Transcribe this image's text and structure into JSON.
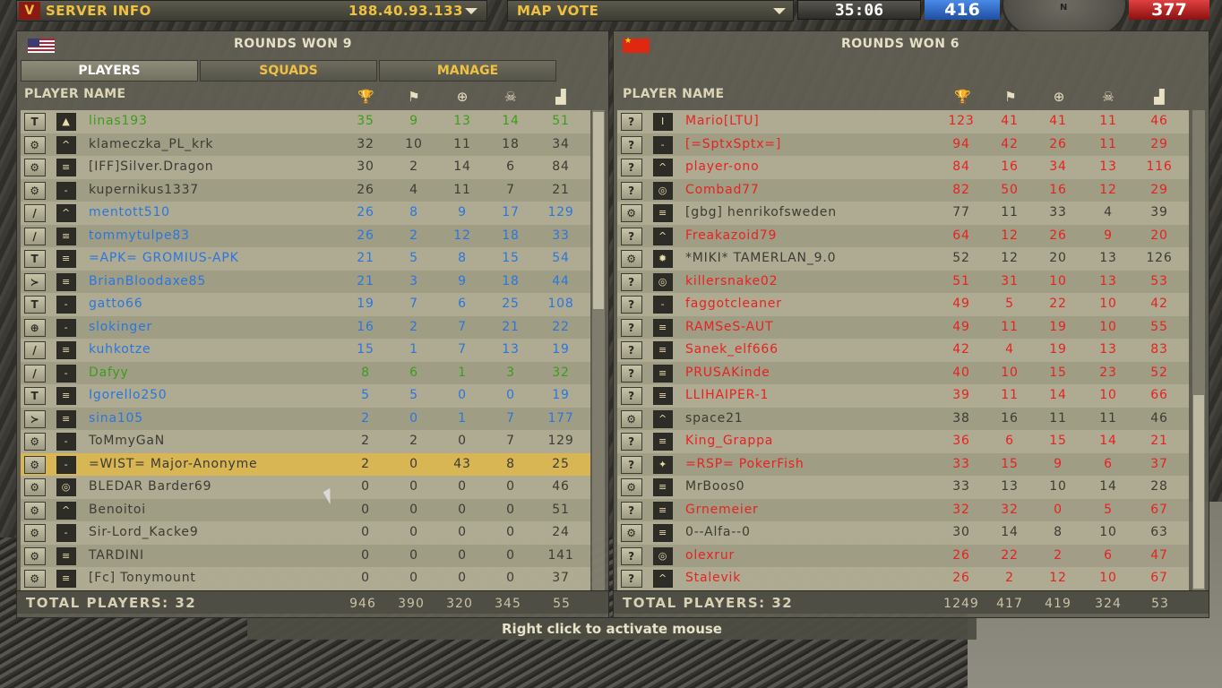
{
  "topbar": {
    "server_label": "SERVER INFO",
    "server_ip": "188.40.93.133",
    "mapvote_label": "MAP VOTE",
    "timer": "35:06",
    "score_us": "416",
    "score_ch": "377",
    "compass_n": "N"
  },
  "headers": {
    "player_name": "PLAYER NAME",
    "icons": [
      "trophy-icon",
      "flag-icon",
      "crosshair-icon",
      "skull-icon",
      "ping-icon"
    ]
  },
  "left": {
    "rounds_won": "ROUNDS WON 9",
    "tabs": [
      "PLAYERS",
      "SQUADS",
      "MANAGE"
    ],
    "total_players": "TOTAL PLAYERS: 32",
    "totals": [
      "946",
      "390",
      "320",
      "345",
      "55"
    ],
    "players": [
      {
        "kit": "T",
        "rank": "▲",
        "name": "linas193",
        "color": "green",
        "s": [
          "35",
          "9",
          "13",
          "14",
          "51"
        ]
      },
      {
        "kit": "⚙",
        "rank": "^",
        "name": "klameczka_PL_krk",
        "color": "black",
        "s": [
          "32",
          "10",
          "11",
          "18",
          "34"
        ]
      },
      {
        "kit": "⚙",
        "rank": "≡",
        "name": "[IFF]Silver.Dragon",
        "color": "black",
        "s": [
          "30",
          "2",
          "14",
          "6",
          "84"
        ]
      },
      {
        "kit": "⚙",
        "rank": "-",
        "name": "kupernikus1337",
        "color": "black",
        "s": [
          "26",
          "4",
          "11",
          "7",
          "21"
        ]
      },
      {
        "kit": "/",
        "rank": "^",
        "name": "mentott510",
        "color": "blue",
        "s": [
          "26",
          "8",
          "9",
          "17",
          "129"
        ]
      },
      {
        "kit": "/",
        "rank": "≡",
        "name": "tommytulpe83",
        "color": "blue",
        "s": [
          "26",
          "2",
          "12",
          "18",
          "33"
        ]
      },
      {
        "kit": "T",
        "rank": "≡",
        "name": "=APK= GROMIUS-APK",
        "color": "blue",
        "s": [
          "21",
          "5",
          "8",
          "15",
          "54"
        ]
      },
      {
        "kit": "≻",
        "rank": "≡",
        "name": "BrianBloodaxe85",
        "color": "blue",
        "s": [
          "21",
          "3",
          "9",
          "18",
          "44"
        ]
      },
      {
        "kit": "T",
        "rank": "-",
        "name": "gatto66",
        "color": "blue",
        "s": [
          "19",
          "7",
          "6",
          "25",
          "108"
        ]
      },
      {
        "kit": "⊕",
        "rank": "-",
        "name": "slokinger",
        "color": "blue",
        "s": [
          "16",
          "2",
          "7",
          "21",
          "22"
        ]
      },
      {
        "kit": "/",
        "rank": "≡",
        "name": "kuhkotze",
        "color": "blue",
        "s": [
          "15",
          "1",
          "7",
          "13",
          "19"
        ]
      },
      {
        "kit": "/",
        "rank": "-",
        "name": "Dafyy",
        "color": "green",
        "s": [
          "8",
          "6",
          "1",
          "3",
          "32"
        ]
      },
      {
        "kit": "T",
        "rank": "≡",
        "name": "Igorello250",
        "color": "blue",
        "s": [
          "5",
          "5",
          "0",
          "0",
          "19"
        ]
      },
      {
        "kit": "≻",
        "rank": "≡",
        "name": "sina105",
        "color": "blue",
        "s": [
          "2",
          "0",
          "1",
          "7",
          "177"
        ]
      },
      {
        "kit": "⚙",
        "rank": "-",
        "name": "ToMmyGaN",
        "color": "black",
        "s": [
          "2",
          "2",
          "0",
          "7",
          "129"
        ]
      },
      {
        "kit": "⚙",
        "rank": "-",
        "name": "=WIST= Major-Anonyme",
        "color": "black",
        "s": [
          "2",
          "0",
          "43",
          "8",
          "25"
        ],
        "hl": true
      },
      {
        "kit": "⚙",
        "rank": "◎",
        "name": "BLEDAR Barder69",
        "color": "black",
        "s": [
          "0",
          "0",
          "0",
          "0",
          "46"
        ]
      },
      {
        "kit": "⚙",
        "rank": "^",
        "name": "Benoitoi",
        "color": "black",
        "s": [
          "0",
          "0",
          "0",
          "0",
          "51"
        ]
      },
      {
        "kit": "⚙",
        "rank": "-",
        "name": "Sir-Lord_Kacke9",
        "color": "black",
        "s": [
          "0",
          "0",
          "0",
          "0",
          "24"
        ]
      },
      {
        "kit": "⚙",
        "rank": "≡",
        "name": "TARDINI",
        "color": "black",
        "s": [
          "0",
          "0",
          "0",
          "0",
          "141"
        ]
      },
      {
        "kit": "⚙",
        "rank": "≡",
        "name": "[Fc] Tonymount",
        "color": "black",
        "s": [
          "0",
          "0",
          "0",
          "0",
          "37"
        ]
      }
    ]
  },
  "right": {
    "rounds_won": "ROUNDS WON 6",
    "total_players": "TOTAL PLAYERS: 32",
    "totals": [
      "1249",
      "417",
      "419",
      "324",
      "53"
    ],
    "players": [
      {
        "kit": "?",
        "rank": "I",
        "name": "Mario[LTU]",
        "color": "red",
        "s": [
          "123",
          "41",
          "41",
          "11",
          "46"
        ]
      },
      {
        "kit": "?",
        "rank": "-",
        "name": "[=SptxSptx=]",
        "color": "red",
        "s": [
          "94",
          "42",
          "26",
          "11",
          "29"
        ]
      },
      {
        "kit": "?",
        "rank": "^",
        "name": "player-ono",
        "color": "red",
        "s": [
          "84",
          "16",
          "34",
          "13",
          "116"
        ]
      },
      {
        "kit": "?",
        "rank": "◎",
        "name": "Combad77",
        "color": "red",
        "s": [
          "82",
          "50",
          "16",
          "12",
          "29"
        ]
      },
      {
        "kit": "⚙",
        "rank": "≡",
        "name": "[gbg] henrikofsweden",
        "color": "black",
        "s": [
          "77",
          "11",
          "33",
          "4",
          "39"
        ]
      },
      {
        "kit": "?",
        "rank": "^",
        "name": "Freakazoid79",
        "color": "red",
        "s": [
          "64",
          "12",
          "26",
          "9",
          "20"
        ]
      },
      {
        "kit": "⚙",
        "rank": "✹",
        "name": "*MIKI* TAMERLAN_9.0",
        "color": "black",
        "s": [
          "52",
          "12",
          "20",
          "13",
          "126"
        ]
      },
      {
        "kit": "?",
        "rank": "◎",
        "name": "killersnake02",
        "color": "red",
        "s": [
          "51",
          "31",
          "10",
          "13",
          "53"
        ]
      },
      {
        "kit": "?",
        "rank": "-",
        "name": "faggotcleaner",
        "color": "red",
        "s": [
          "49",
          "5",
          "22",
          "10",
          "42"
        ]
      },
      {
        "kit": "?",
        "rank": "≡",
        "name": "RAMSeS-AUT",
        "color": "red",
        "s": [
          "49",
          "11",
          "19",
          "10",
          "55"
        ]
      },
      {
        "kit": "?",
        "rank": "≡",
        "name": "Sanek_elf666",
        "color": "red",
        "s": [
          "42",
          "4",
          "19",
          "13",
          "83"
        ]
      },
      {
        "kit": "?",
        "rank": "≡",
        "name": "PRUSAKinde",
        "color": "red",
        "s": [
          "40",
          "10",
          "15",
          "23",
          "52"
        ]
      },
      {
        "kit": "?",
        "rank": "≡",
        "name": "LLIHAIPER-1",
        "color": "red",
        "s": [
          "39",
          "11",
          "14",
          "10",
          "66"
        ]
      },
      {
        "kit": "⚙",
        "rank": "^",
        "name": "space21",
        "color": "black",
        "s": [
          "38",
          "16",
          "11",
          "11",
          "46"
        ]
      },
      {
        "kit": "?",
        "rank": "≡",
        "name": "King_Grappa",
        "color": "red",
        "s": [
          "36",
          "6",
          "15",
          "14",
          "21"
        ]
      },
      {
        "kit": "?",
        "rank": "✦",
        "name": "=RSP= PokerFish",
        "color": "red",
        "s": [
          "33",
          "15",
          "9",
          "6",
          "37"
        ]
      },
      {
        "kit": "⚙",
        "rank": "≡",
        "name": "MrBoos0",
        "color": "black",
        "s": [
          "33",
          "13",
          "10",
          "14",
          "28"
        ]
      },
      {
        "kit": "?",
        "rank": "≡",
        "name": "Grnemeier",
        "color": "red",
        "s": [
          "32",
          "32",
          "0",
          "5",
          "67"
        ]
      },
      {
        "kit": "⚙",
        "rank": "≡",
        "name": "0--Alfa--0",
        "color": "black",
        "s": [
          "30",
          "14",
          "8",
          "10",
          "63"
        ]
      },
      {
        "kit": "?",
        "rank": "◎",
        "name": "olexrur",
        "color": "red",
        "s": [
          "26",
          "22",
          "2",
          "6",
          "47"
        ]
      },
      {
        "kit": "?",
        "rank": "^",
        "name": "Stalevik",
        "color": "red",
        "s": [
          "26",
          "2",
          "12",
          "10",
          "67"
        ]
      }
    ]
  },
  "hint": "Right click to activate mouse"
}
